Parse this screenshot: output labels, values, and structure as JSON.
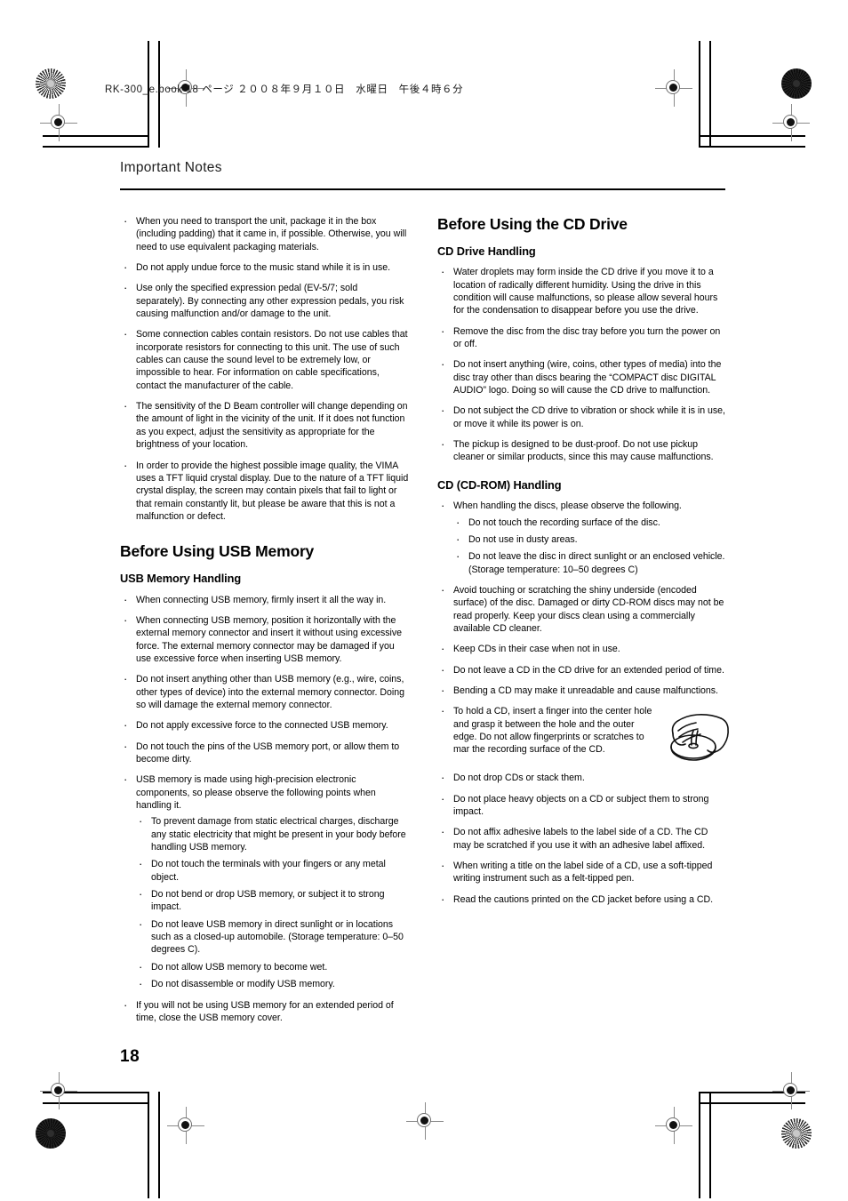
{
  "book_header": "RK-300_e.book 18 ページ  ２００８年９月１０日　水曜日　午後４時６分",
  "running_head": "Important Notes",
  "page_number": "18",
  "figures": {
    "cd_hold": "hand-holding-cd-illustration"
  },
  "left_column": {
    "intro_bullets": [
      "When you need to transport the unit, package it in the box (including padding) that it came in, if possible. Otherwise, you will need to use equivalent packaging materials.",
      "Do not apply undue force to the music stand while it is in use.",
      "Use only the specified expression pedal (EV-5/7; sold separately). By connecting any other expression pedals, you risk causing malfunction and/or damage to the unit.",
      "Some connection cables contain resistors. Do not use cables that incorporate resistors for connecting to this unit. The use of such cables can cause the sound level to be extremely low, or impossible to hear. For information on cable specifications, contact the manufacturer of the cable.",
      "The sensitivity of the D Beam controller will change depending on the amount of light in the vicinity of the unit. If it does not function as you expect, adjust the sensitivity as appropriate for the brightness of your location.",
      "In order to provide the highest possible image quality, the VIMA uses a TFT liquid crystal display. Due to the nature of a TFT liquid crystal display, the screen may contain pixels that fail to light or that remain constantly lit, but please be aware that this is not a malfunction or defect."
    ],
    "usb_section_title": "Before Using USB Memory",
    "usb_subsection_title": "USB Memory Handling",
    "usb_bullets": [
      "When connecting USB memory, firmly insert it all the way in.",
      "When connecting USB memory, position it horizontally with the external memory connector and insert it without using excessive force. The external memory connector may be damaged if you use excessive force when inserting USB memory.",
      "Do not insert anything other than USB memory (e.g., wire, coins, other types of device) into the external memory connector. Doing so will damage the external memory connector.",
      "Do not apply excessive force to the connected USB memory.",
      "Do not touch the pins of the USB memory port, or allow them to become dirty."
    ],
    "usb_precision_lead": "USB memory is made using high-precision electronic components, so please observe the following points when handling it.",
    "usb_precision_subbullets": [
      "To prevent damage from static electrical charges, discharge any static electricity that might be present in your body before handling USB memory.",
      "Do not touch the terminals with your fingers or any metal object.",
      "Do not bend or drop USB memory, or subject it to strong impact.",
      "Do not leave USB memory in direct sunlight or in locations such as a closed-up automobile. (Storage temperature: 0–50 degrees C).",
      "Do not allow USB memory to become wet.",
      "Do not disassemble or modify USB memory."
    ],
    "usb_closing_bullet": "If you will not be using USB memory for an extended period of time, close the USB memory cover."
  },
  "right_column": {
    "cd_drive_section_title": "Before Using the CD Drive",
    "cd_drive_subsection_title": "CD Drive Handling",
    "cd_drive_bullets": [
      "Water droplets may form inside the CD drive if you move it to a location of radically different humidity. Using the drive in this condition will cause malfunctions, so please allow several hours for the condensation to disappear before you use the drive.",
      "Remove the disc from the disc tray before you turn the power on or off.",
      "Do not insert anything (wire, coins, other types of media) into the disc tray other than discs bearing the “COMPACT disc DIGITAL AUDIO” logo. Doing so will cause the CD drive to malfunction.",
      "Do not subject the CD drive to vibration or shock while it is in use, or move it while its power is on.",
      "The pickup is designed to be dust-proof. Do not use pickup cleaner or similar products, since this may cause malfunctions."
    ],
    "cdrom_subsection_title": "CD (CD-ROM) Handling",
    "cdrom_handling_lead": "When handling the discs, please observe the following.",
    "cdrom_handling_subbullets": [
      "Do not touch the recording surface of the disc.",
      "Do not use in dusty areas.",
      "Do not leave the disc in direct sunlight or an enclosed vehicle. (Storage temperature: 10–50 degrees C)"
    ],
    "cdrom_bullets_a": [
      "Avoid touching or scratching the shiny underside (encoded surface) of the disc. Damaged or dirty CD-ROM discs may not be read properly. Keep your discs clean using a commercially available CD cleaner.",
      "Keep CDs in their case when not in use.",
      "Do not leave a CD in the CD drive for an extended period of time.",
      "Bending a CD may make it unreadable and cause malfunctions."
    ],
    "cdrom_hold_bullet": "To hold a CD, insert a finger into the center hole and grasp it between the hole and the outer edge. Do not allow fingerprints or scratches to mar the recording surface of the CD.",
    "cdrom_bullets_b": [
      "Do not drop CDs or stack them.",
      "Do not place heavy objects on a CD or subject them to strong impact.",
      "Do not affix adhesive labels to the label side of a CD. The CD may be scratched if you use it with an adhesive label affixed.",
      "When writing a title on the label side of a CD, use a soft-tipped writing instrument such as a felt-tipped pen.",
      "Read the cautions printed on the CD jacket before using a CD."
    ]
  }
}
